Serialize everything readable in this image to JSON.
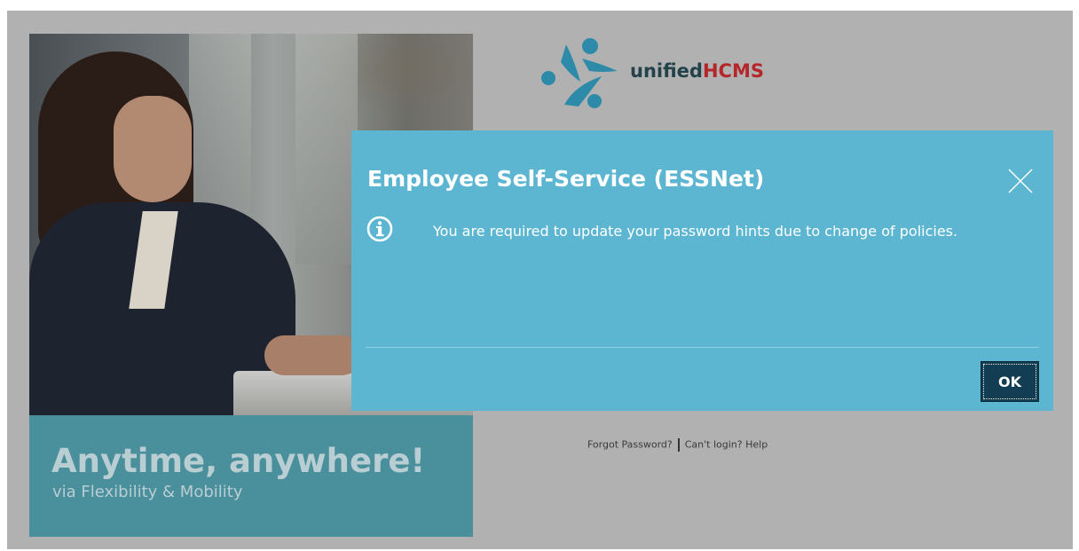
{
  "promo": {
    "headline": "Anytime, anywhere!",
    "subheadline": "via Flexibility & Mobility"
  },
  "logo": {
    "text_part1": "unified",
    "text_part2": "HCMS",
    "colors": {
      "dark": "#23414a",
      "red": "#b5262b",
      "teal": "#2d8aa8"
    }
  },
  "login_links": {
    "forgot_password": "Forgot Password?",
    "cant_login": "Can't login? Help"
  },
  "dialog": {
    "title": "Employee Self-Service (ESSNet)",
    "message": "You are required to update your password hints due to change of policies.",
    "ok_label": "OK",
    "info_icon": "info-circle-icon",
    "close_icon": "close-icon",
    "background_color": "#5cb6d1",
    "button_color": "#123d52"
  },
  "overlay_color": "#b1b1b1"
}
